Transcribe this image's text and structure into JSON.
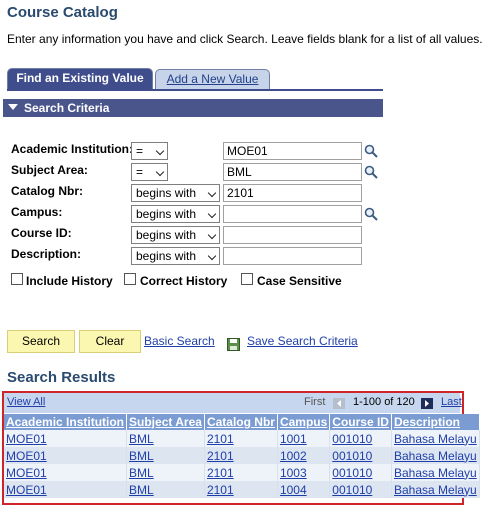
{
  "page": {
    "title": "Course Catalog",
    "instructions": "Enter any information you have and click Search. Leave fields blank for a list of all values."
  },
  "tabs": {
    "find": "Find an Existing Value",
    "add": "Add a New Value"
  },
  "criteria": {
    "header": "Search Criteria",
    "fields": [
      {
        "label": "Academic Institution:",
        "operator": "=",
        "value": "MOE01"
      },
      {
        "label": "Subject Area:",
        "operator": "=",
        "value": "BML"
      },
      {
        "label": "Catalog Nbr:",
        "operator": "begins with",
        "value": "2101"
      },
      {
        "label": "Campus:",
        "operator": "begins with",
        "value": ""
      },
      {
        "label": "Course ID:",
        "operator": "begins with",
        "value": ""
      },
      {
        "label": "Description:",
        "operator": "begins with",
        "value": ""
      }
    ],
    "checkboxes": {
      "include_history": "Include History",
      "correct_history": "Correct History",
      "case_sensitive": "Case Sensitive"
    }
  },
  "actions": {
    "search": "Search",
    "clear": "Clear",
    "basic_search": "Basic Search",
    "save_search": "Save Search Criteria"
  },
  "results": {
    "title": "Search Results",
    "view_all": "View All",
    "first": "First",
    "count": "1-100 of 120",
    "last": "Last",
    "columns": [
      "Academic Institution",
      "Subject Area",
      "Catalog Nbr",
      "Campus",
      "Course ID",
      "Description"
    ],
    "rows": [
      [
        "MOE01",
        "BML",
        "2101",
        "1001",
        "001010",
        "Bahasa Melayu"
      ],
      [
        "MOE01",
        "BML",
        "2101",
        "1002",
        "001010",
        "Bahasa Melayu"
      ],
      [
        "MOE01",
        "BML",
        "2101",
        "1003",
        "001010",
        "Bahasa Melayu"
      ],
      [
        "MOE01",
        "BML",
        "2101",
        "1004",
        "001010",
        "Bahasa Melayu"
      ]
    ]
  },
  "colors": {
    "title": "#2a4a6f",
    "tab_active": "#3f4d8c",
    "grid_header": "#7a9cd2",
    "highlight_frame": "#d0242b",
    "button": "#fcf7b0"
  },
  "icons": {
    "lookup": "magnifier-icon",
    "save": "floppy-disk-icon",
    "prev": "prev-arrow-icon",
    "next": "next-arrow-icon"
  }
}
